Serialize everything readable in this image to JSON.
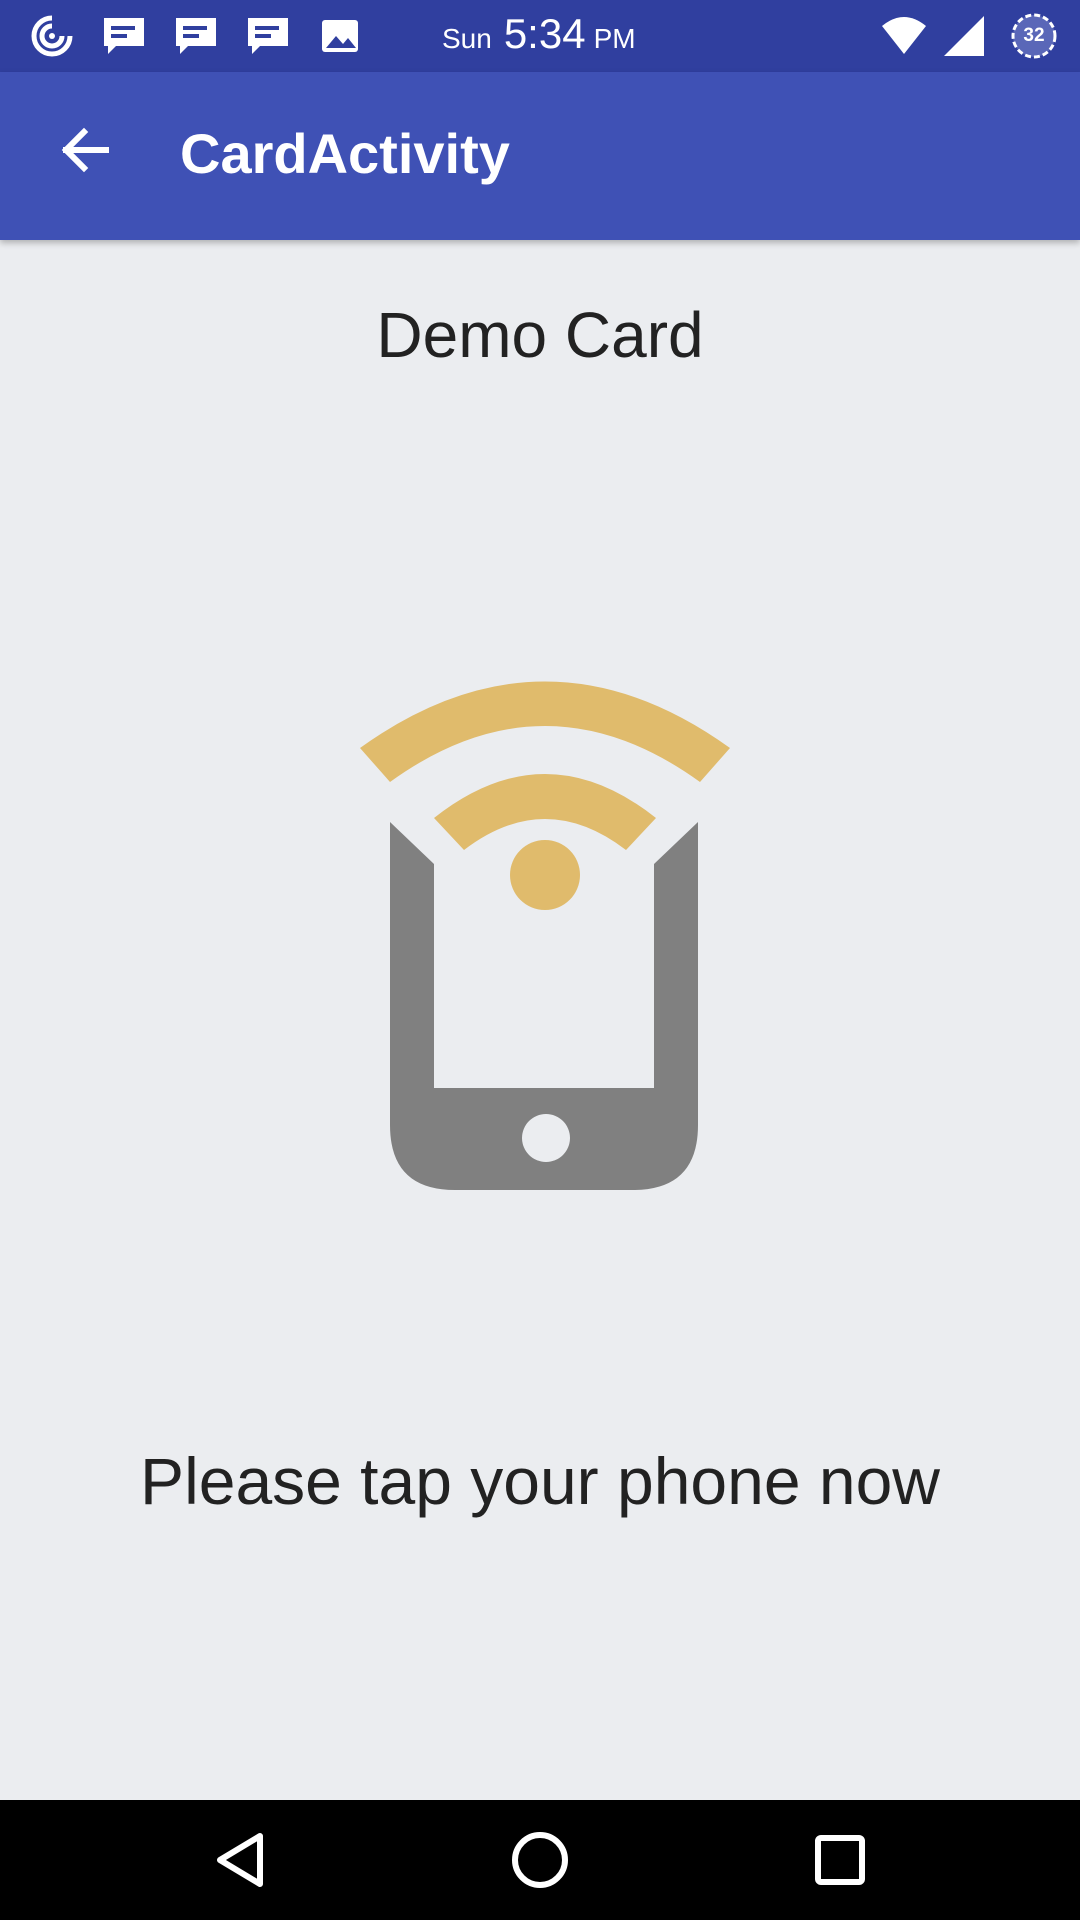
{
  "status_bar": {
    "day": "Sun",
    "time": "5:34",
    "ampm": "PM",
    "battery_level": "32",
    "notification_icons": [
      "sync-icon",
      "message-icon",
      "message-icon",
      "message-icon",
      "image-icon"
    ],
    "system_icons": [
      "wifi-icon",
      "cell-signal-icon",
      "battery-icon"
    ]
  },
  "app_bar": {
    "title": "CardActivity",
    "back_icon": "arrow-back-icon",
    "color": "#3f51b5"
  },
  "main": {
    "card_name": "Demo Card",
    "illustration_icon": "nfc-phone-icon",
    "instruction": "Please tap your phone now",
    "accent_color": "#e0bb6c",
    "phone_color": "#808080"
  },
  "nav_bar": {
    "buttons": [
      "back-triangle-icon",
      "home-circle-icon",
      "recents-square-icon"
    ]
  }
}
